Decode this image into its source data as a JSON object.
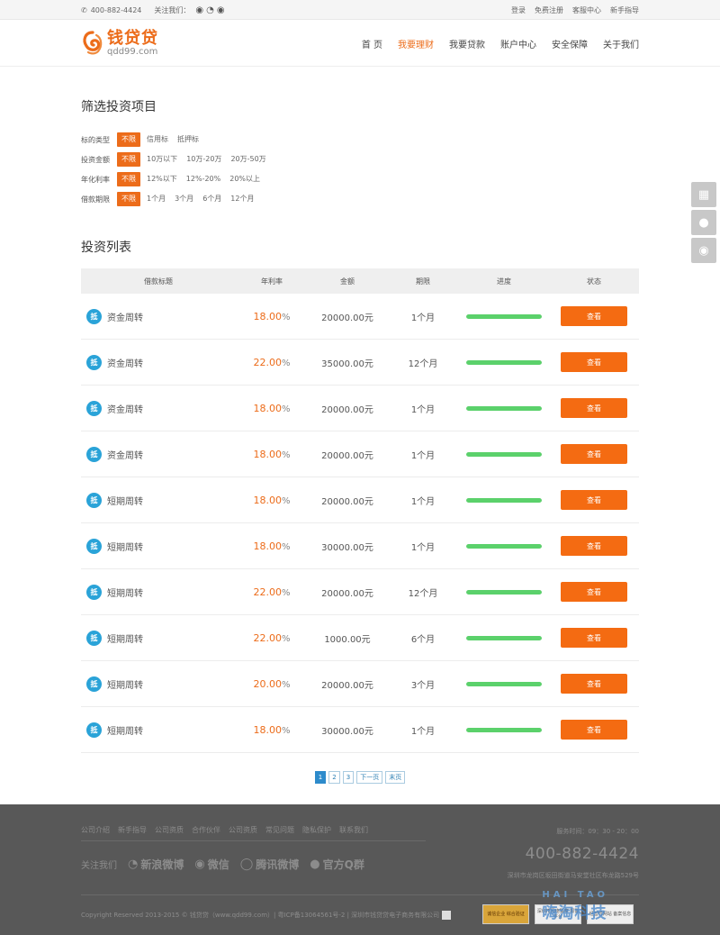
{
  "topbar": {
    "phone": "400-882-4424",
    "follow_label": "关注我们：",
    "social_icons": [
      "wechat-icon",
      "weibo-icon",
      "wechat-alt-icon"
    ],
    "links": [
      "登录",
      "免费注册",
      "客服中心",
      "新手指导"
    ]
  },
  "header": {
    "logo_cn": "钱贷贷",
    "logo_en": "qdd99.com",
    "nav": [
      {
        "label": "首  页",
        "active": false
      },
      {
        "label": "我要理财",
        "active": true
      },
      {
        "label": "我要贷款",
        "active": false
      },
      {
        "label": "账户中心",
        "active": false
      },
      {
        "label": "安全保障",
        "active": false
      },
      {
        "label": "关于我们",
        "active": false
      }
    ]
  },
  "filter": {
    "title": "筛选投资项目",
    "rows": [
      {
        "label": "标的类型",
        "options": [
          "不限",
          "信用标",
          "抵押标"
        ],
        "selected": 0
      },
      {
        "label": "投资金额",
        "options": [
          "不限",
          "10万以下",
          "10万-20万",
          "20万-50万"
        ],
        "selected": 0
      },
      {
        "label": "年化利率",
        "options": [
          "不限",
          "12%以下",
          "12%-20%",
          "20%以上"
        ],
        "selected": 0
      },
      {
        "label": "借款期限",
        "options": [
          "不限",
          "1个月",
          "3个月",
          "6个月",
          "12个月"
        ],
        "selected": 0
      }
    ]
  },
  "list": {
    "title": "投资列表",
    "columns": [
      "借款标题",
      "年利率",
      "金额",
      "期限",
      "进度",
      "状态"
    ],
    "badge_text": "抵",
    "button_label": "查看",
    "accent_color": "#ec6c1a",
    "progress_color": "#5bd16b",
    "rows": [
      {
        "title": "资金周转",
        "rate": "18.00",
        "amount": "20000.00元",
        "term": "1个月",
        "progress": 1.0
      },
      {
        "title": "资金周转",
        "rate": "22.00",
        "amount": "35000.00元",
        "term": "12个月",
        "progress": 1.0
      },
      {
        "title": "资金周转",
        "rate": "18.00",
        "amount": "20000.00元",
        "term": "1个月",
        "progress": 1.0
      },
      {
        "title": "资金周转",
        "rate": "18.00",
        "amount": "20000.00元",
        "term": "1个月",
        "progress": 1.0
      },
      {
        "title": "短期周转",
        "rate": "18.00",
        "amount": "20000.00元",
        "term": "1个月",
        "progress": 1.0
      },
      {
        "title": "短期周转",
        "rate": "18.00",
        "amount": "30000.00元",
        "term": "1个月",
        "progress": 1.0
      },
      {
        "title": "短期周转",
        "rate": "22.00",
        "amount": "20000.00元",
        "term": "12个月",
        "progress": 1.0
      },
      {
        "title": "短期周转",
        "rate": "22.00",
        "amount": "1000.00元",
        "term": "6个月",
        "progress": 1.0
      },
      {
        "title": "短期周转",
        "rate": "20.00",
        "amount": "20000.00元",
        "term": "3个月",
        "progress": 1.0
      },
      {
        "title": "短期周转",
        "rate": "18.00",
        "amount": "30000.00元",
        "term": "1个月",
        "progress": 1.0
      }
    ]
  },
  "pager": {
    "pages": [
      "1",
      "2",
      "3"
    ],
    "current": "1",
    "next": "下一页",
    "last": "末页"
  },
  "side_float": [
    "qrcode-icon",
    "qq-icon",
    "chat-icon"
  ],
  "footer": {
    "links": [
      "公司介绍",
      "新手指导",
      "公司资质",
      "合作伙伴",
      "公司资质",
      "常见问题",
      "隐私保护",
      "联系我们"
    ],
    "follow_label": "关注我们",
    "follow_items": [
      {
        "icon": "weibo-icon",
        "label": "新浪微博"
      },
      {
        "icon": "wechat-icon",
        "label": "微信"
      },
      {
        "icon": "tencent-weibo-icon",
        "label": "腾讯微博"
      },
      {
        "icon": "qq-icon",
        "label": "官方Q群"
      }
    ],
    "hours": "服务时间：09：30 - 20：00",
    "phone": "400-882-4424",
    "address": "深圳市龙岗区坂田街道马安堂社区布龙路529号",
    "copyright": "Copyright Reserved 2013-2015 © 钱贷贷（www.qdd99.com）| 粤ICP备13064561号-2 | 深圳市钱贷贷电子商务有限公司",
    "badges": [
      "诚信企业 综合验证",
      "深圳市网络警察 报警平台",
      "经营性网站 备案信息"
    ],
    "watermark_top": "HAI TAO",
    "watermark_bottom": "嗨淘科技"
  }
}
